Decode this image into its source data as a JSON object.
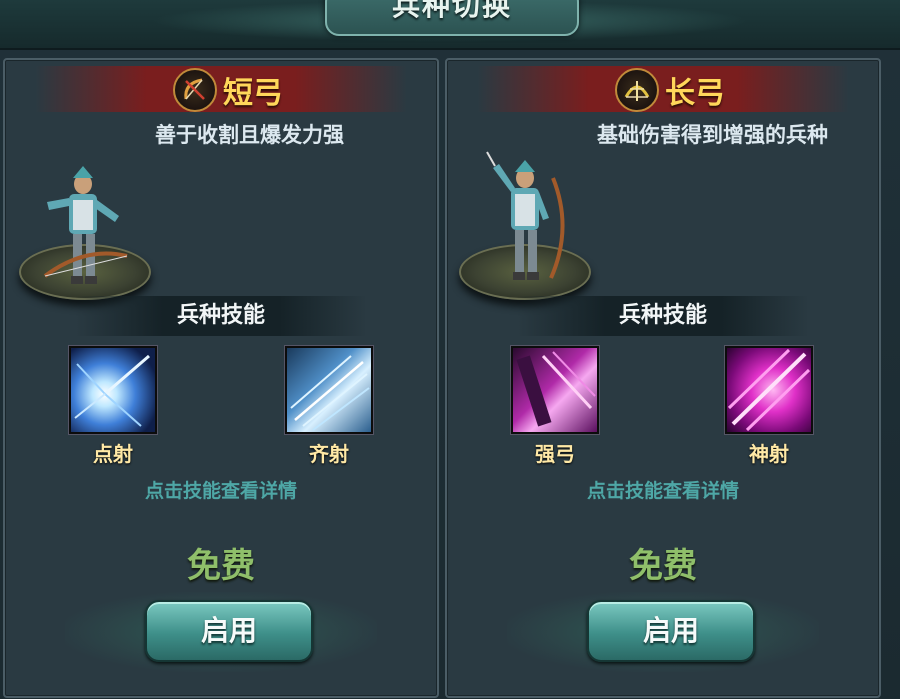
{
  "window_title": "兵种切换",
  "panels": [
    {
      "name": "短弓",
      "description": "善于收割且爆发力强",
      "skills_title": "兵种技能",
      "skills": [
        {
          "label": "点射",
          "icon": "burst-shot-icon"
        },
        {
          "label": "齐射",
          "icon": "volley-icon"
        }
      ],
      "hint": "点击技能查看详情",
      "price": "免费",
      "button_label": "启用"
    },
    {
      "name": "长弓",
      "description": "基础伤害得到增强的兵种",
      "skills_title": "兵种技能",
      "skills": [
        {
          "label": "强弓",
          "icon": "power-bow-icon"
        },
        {
          "label": "神射",
          "icon": "divine-shot-icon"
        }
      ],
      "hint": "点击技能查看详情",
      "price": "免费",
      "button_label": "启用"
    }
  ],
  "colors": {
    "unit_name": "#ffd75a",
    "price": "#8fbf6a",
    "hint": "#4ea7a6",
    "button": "#3e8f89"
  }
}
